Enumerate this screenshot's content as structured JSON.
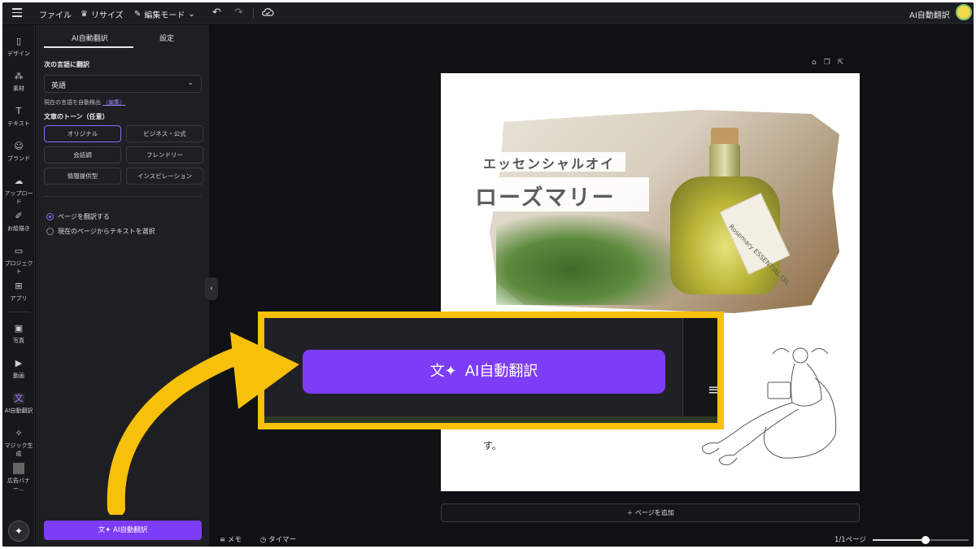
{
  "topbar": {
    "file": "ファイル",
    "resize": "リサイズ",
    "edit_mode": "編集モード",
    "doc_title": "AI自動翻訳"
  },
  "rail": {
    "items": [
      {
        "label": "デザイン",
        "icon": "design-icon"
      },
      {
        "label": "素材",
        "icon": "elements-icon"
      },
      {
        "label": "テキスト",
        "icon": "text-icon"
      },
      {
        "label": "ブランド",
        "icon": "brand-icon"
      },
      {
        "label": "アップロード",
        "icon": "upload-icon"
      },
      {
        "label": "お絵描き",
        "icon": "draw-icon"
      },
      {
        "label": "プロジェクト",
        "icon": "folder-icon"
      },
      {
        "label": "アプリ",
        "icon": "apps-icon"
      },
      {
        "label": "写真",
        "icon": "photo-icon"
      },
      {
        "label": "動画",
        "icon": "video-icon"
      },
      {
        "label": "AI自動翻訳",
        "icon": "translate-icon"
      },
      {
        "label": "マジック生成",
        "icon": "magic-media-icon"
      },
      {
        "label": "広告バナー...",
        "icon": "ad-banner-icon"
      }
    ]
  },
  "panel": {
    "tabs": [
      "AI自動翻訳",
      "設定"
    ],
    "translate_to_label": "次の言語に翻訳",
    "language": "英語",
    "detect_text": "現在の言語を自動検出",
    "detect_edit": "（編集）",
    "tone_label": "文章のトーン（任意）",
    "tones": [
      "オリジナル",
      "ビジネス・公式",
      "会話調",
      "フレンドリー",
      "情報提供型",
      "インスピレーション"
    ],
    "selected_tone": "オリジナル",
    "radio_options": [
      "ページを翻訳する",
      "現在のページからテキストを選択"
    ],
    "selected_radio": "ページを翻訳する",
    "action_button": "AI自動翻訳"
  },
  "canvas": {
    "title_line1": "エッセンシャルオイ",
    "title_line2": "ローズマリー",
    "tag_text": "Rosemary ESSENTIAL OIL",
    "body_text": "す。",
    "add_page": "＋ ページを追加"
  },
  "callout": {
    "button_label": "AI自動翻訳"
  },
  "bottombar": {
    "memo": "メモ",
    "timer": "タイマー",
    "pages": "1/1ページ",
    "zoom_fraction": 0.55
  },
  "colors": {
    "accent": "#7d3cf5",
    "callout_border": "#f7c00a",
    "app_bg": "#0f1114",
    "panel_bg": "#1e1f23"
  }
}
